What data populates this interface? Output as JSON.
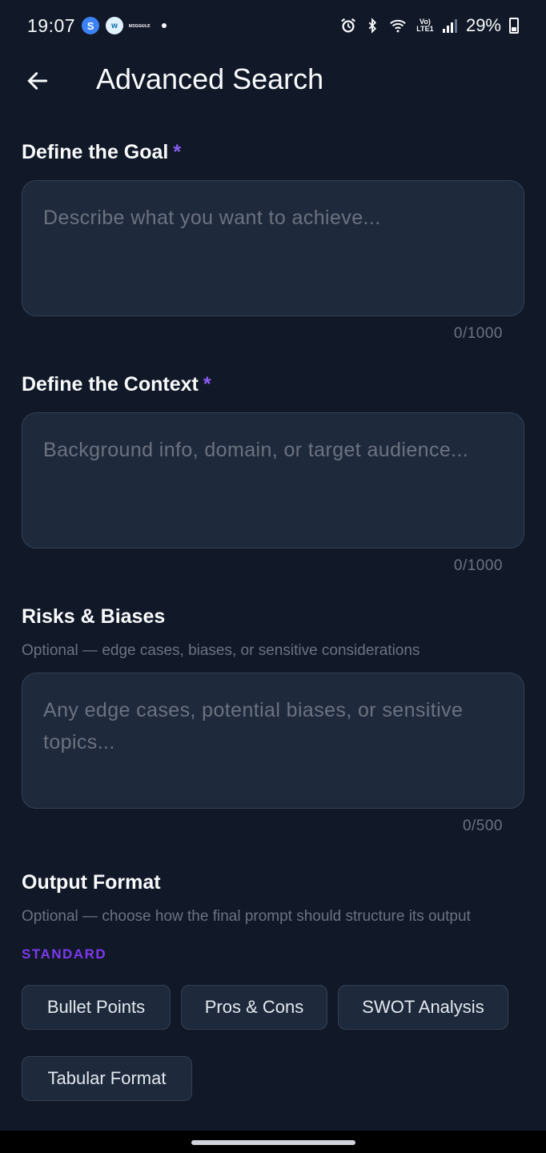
{
  "status_bar": {
    "time": "19:07",
    "app_icons": [
      "S",
      "w",
      "ᴍɪɢɢᴜʟᴇ"
    ],
    "icons": [
      "alarm-icon",
      "bluetooth-icon",
      "wifi-icon",
      "volte-icon",
      "signal-icon",
      "battery-icon"
    ],
    "volte_text": "Vo) LTE1",
    "battery_percent": "29%",
    "battery_level": 0.29
  },
  "header": {
    "title": "Advanced Search"
  },
  "goal": {
    "label": "Define the Goal",
    "required_marker": "*",
    "placeholder": "Describe what you want to achieve...",
    "value": "",
    "counter": "0/1000"
  },
  "context": {
    "label": "Define the Context",
    "required_marker": "*",
    "placeholder": "Background info, domain, or target audience...",
    "value": "",
    "counter": "0/1000"
  },
  "risks": {
    "label": "Risks & Biases",
    "helper": "Optional — edge cases, biases, or sensitive considerations",
    "placeholder": "Any edge cases, potential biases, or sensitive topics...",
    "value": "",
    "counter": "0/500"
  },
  "output_format": {
    "label": "Output Format",
    "helper": "Optional — choose how the final prompt should structure its output",
    "group_label": "STANDARD",
    "options": [
      "Bullet Points",
      "Pros & Cons",
      "SWOT Analysis",
      "Tabular Format"
    ]
  },
  "colors": {
    "background": "#111827",
    "field": "#1e293b",
    "accent": "#8b5cf6"
  }
}
